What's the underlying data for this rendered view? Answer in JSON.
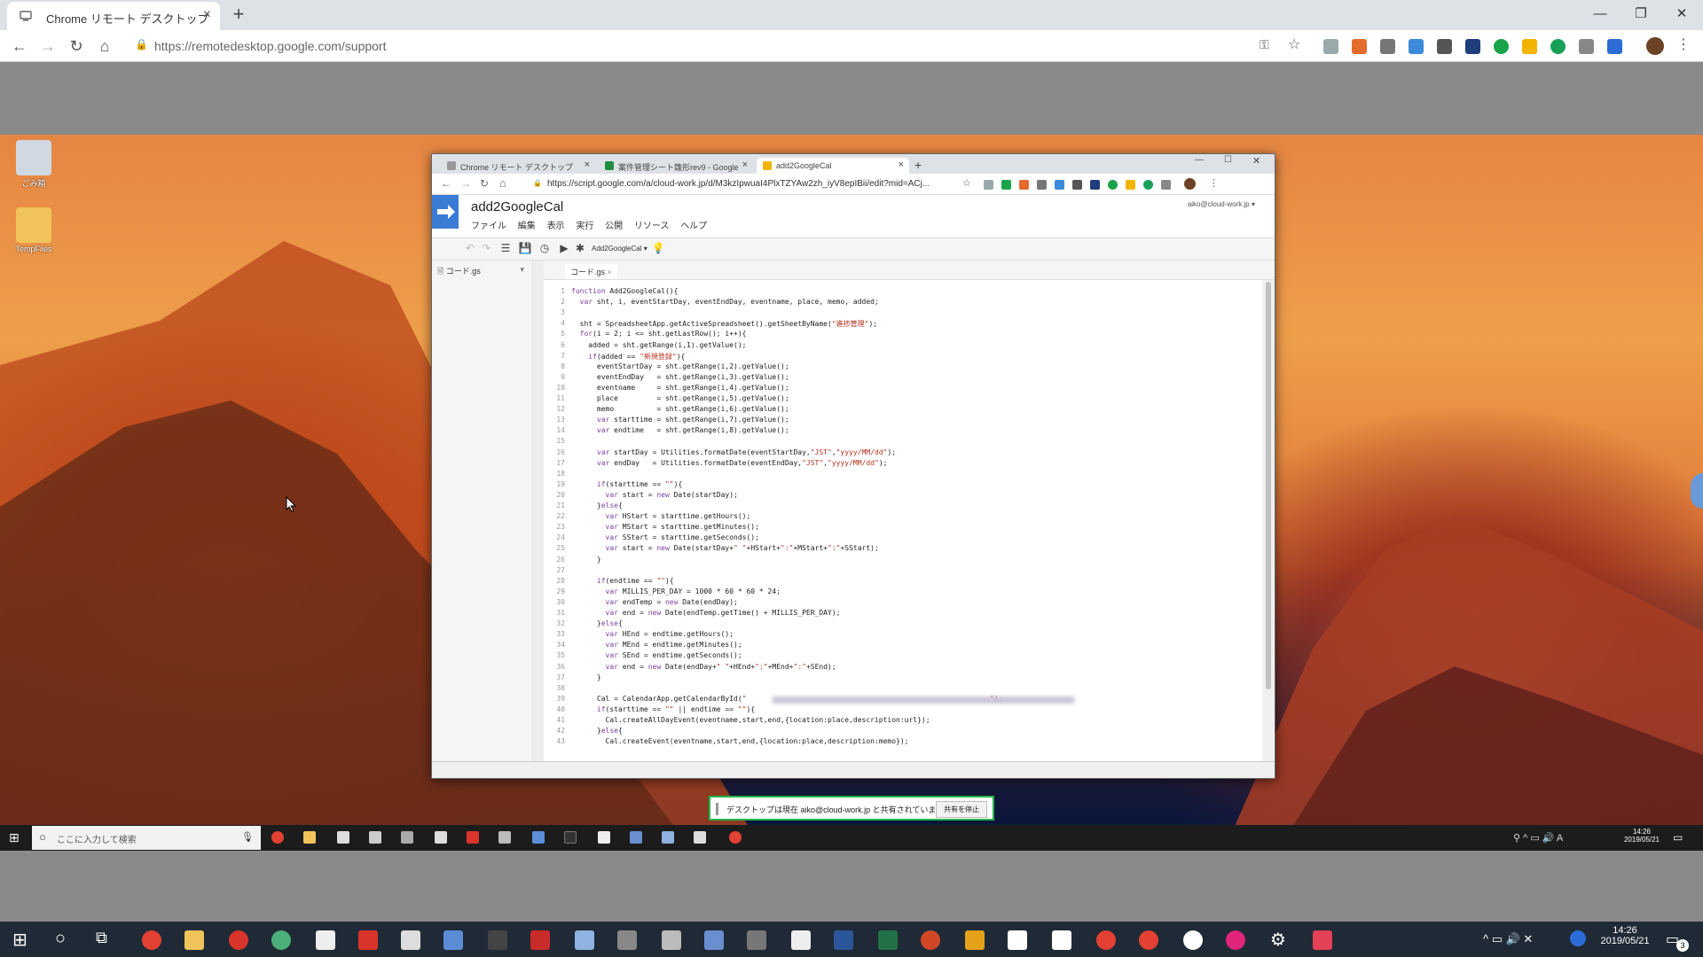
{
  "outer_browser": {
    "tab_title": "Chrome リモート デスクトップ",
    "url": "https://remotedesktop.google.com/support"
  },
  "desktop_icons": [
    {
      "label": "ごみ箱"
    },
    {
      "label": "TempFiles"
    }
  ],
  "inner_browser": {
    "tabs": [
      {
        "title": "Chrome リモート デスクトップ"
      },
      {
        "title": "案件管理シート雛形rev9 - Google"
      },
      {
        "title": "add2GoogleCal"
      }
    ],
    "url": "https://script.google.com/a/cloud-work.jp/d/M3kzIpwuaI4PlxTZYAw2zh_iyV8epIBii/edit?mid=ACj..."
  },
  "script_editor": {
    "project_title": "add2GoogleCal",
    "user": "aiko@cloud-work.jp",
    "menu": [
      "ファイル",
      "編集",
      "表示",
      "実行",
      "公開",
      "リソース",
      "ヘルプ"
    ],
    "function_select": "Add2GoogleCal",
    "file_item": "コード.gs",
    "editor_tab": "コード.gs",
    "code_lines": [
      "function Add2GoogleCal(){",
      "  var sht, i, eventStartDay, eventEndDay, eventname, place, memo, added;",
      "",
      "  sht = SpreadsheetApp.getActiveSpreadsheet().getSheetByName(\"進捗管理\");",
      "  for(i = 2; i <= sht.getLastRow(); i++){",
      "    added = sht.getRange(i,1).getValue();",
      "    if(added == \"新規登録\"){",
      "      eventStartDay = sht.getRange(i,2).getValue();",
      "      eventEndDay   = sht.getRange(i,3).getValue();",
      "      eventname     = sht.getRange(i,4).getValue();",
      "      place         = sht.getRange(i,5).getValue();",
      "      memo          = sht.getRange(i,6).getValue();",
      "      var starttime = sht.getRange(i,7).getValue();",
      "      var endtime   = sht.getRange(i,8).getValue();",
      "",
      "      var startDay = Utilities.formatDate(eventStartDay,\"JST\",\"yyyy/MM/dd\");",
      "      var endDay   = Utilities.formatDate(eventEndDay,\"JST\",\"yyyy/MM/dd\");",
      "",
      "      if(starttime == \"\"){",
      "        var start = new Date(startDay);",
      "      }else{",
      "        var HStart = starttime.getHours();",
      "        var MStart = starttime.getMinutes();",
      "        var SStart = starttime.getSeconds();",
      "        var start = new Date(startDay+\" \"+HStart+\":\"+MStart+\":\"+SStart);",
      "      }",
      "",
      "      if(endtime == \"\"){",
      "        var MILLIS_PER_DAY = 1000 * 60 * 60 * 24;",
      "        var endTemp = new Date(endDay);",
      "        var end = new Date(endTemp.getTime() + MILLIS_PER_DAY);",
      "      }else{",
      "        var HEnd = endtime.getHours();",
      "        var MEnd = endtime.getMinutes();",
      "        var SEnd = endtime.getSeconds();",
      "        var end = new Date(endDay+\" \"+HEnd+\":\"+MEnd+\":\"+SEnd);",
      "      }",
      "",
      "      Cal = CalendarApp.getCalendarById(\"                                                         \");",
      "      if(starttime == \"\" || endtime == \"\"){",
      "        Cal.createAllDayEvent(eventname,start,end,{location:place,description:url});",
      "      }else{",
      "        Cal.createEvent(eventname,start,end,{location:place,description:memo});"
    ]
  },
  "remote_share_bar": {
    "message": "デスクトップは現在 aiko@cloud-work.jp と共有されています。",
    "stop_button": "共有を停止"
  },
  "remote_taskbar": {
    "search_placeholder": "ここに入力して検索",
    "time": "14:26",
    "date": "2019/05/21"
  },
  "local_taskbar": {
    "time": "14:26",
    "date": "2019/05/21",
    "notifications": "3"
  },
  "colors": {
    "accent_blue": "#3a7bd5",
    "share_green": "#24b44a",
    "keyword": "#7a3e9d",
    "variable": "#2b55b5",
    "string": "#b5301c",
    "number": "#0b7a3e"
  }
}
